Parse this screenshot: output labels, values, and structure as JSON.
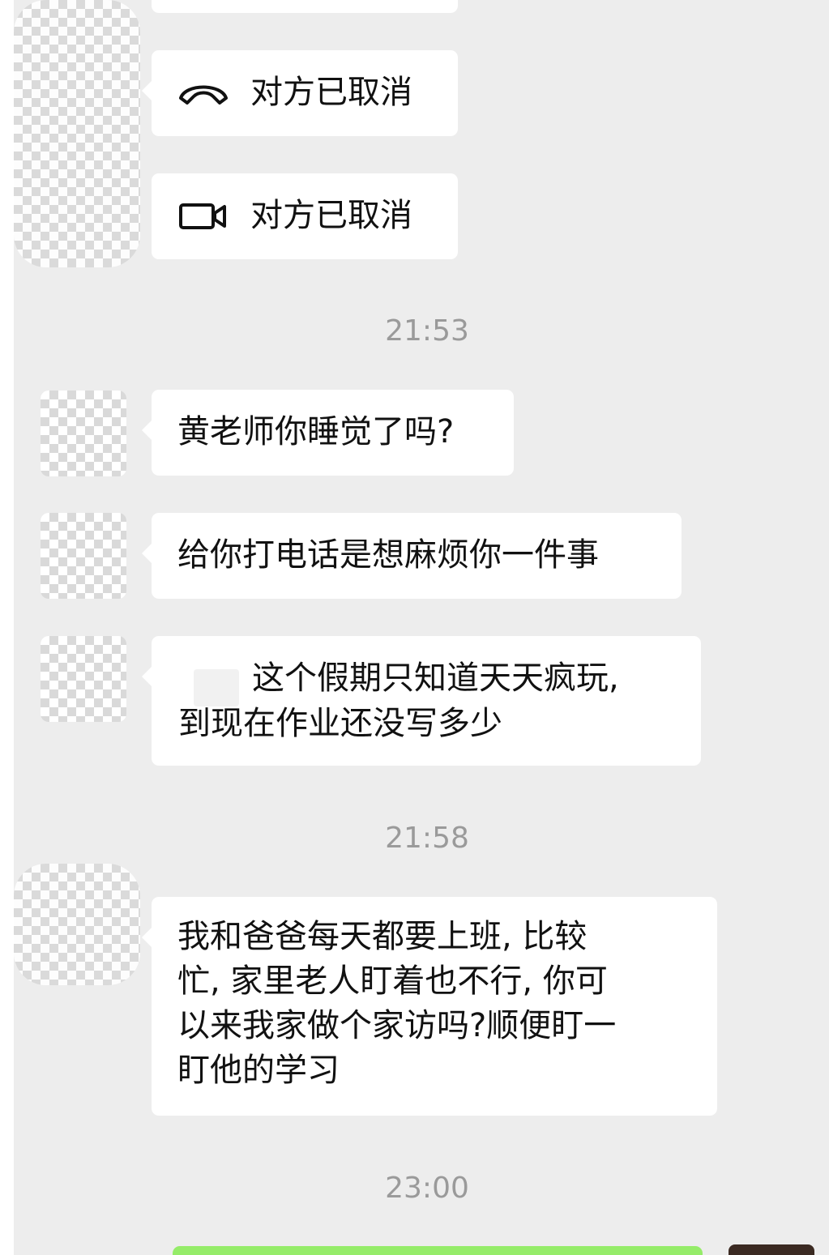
{
  "messages": {
    "call_voice": {
      "icon": "phone-hangup-icon",
      "text": "对方已取消"
    },
    "call_video": {
      "icon": "video-camera-icon",
      "text": "对方已取消"
    },
    "time_1": "21:53",
    "msg_1": "黄老师你睡觉了吗?",
    "msg_2": "给你打电话是想麻烦你一件事",
    "msg_3_line1": "这个假期只知道天天疯玩,",
    "msg_3_line2": "到现在作业还没写多少",
    "time_2": "21:58",
    "msg_4_lines": [
      "我和爸爸每天都要上班, 比较",
      "忙, 家里老人盯着也不行, 你可",
      "以来我家做个家访吗?顺便盯一",
      "盯他的学习"
    ],
    "time_3": "23:00"
  },
  "colors": {
    "chat_background": "#ededed",
    "bubble_incoming": "#ffffff",
    "bubble_outgoing": "#95ec69",
    "timestamp": "#9a9a9a"
  }
}
